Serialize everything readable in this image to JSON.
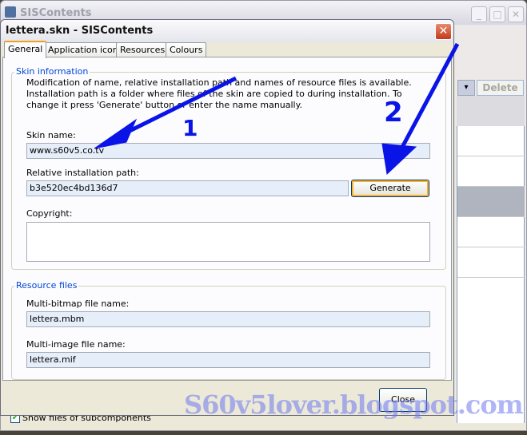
{
  "background_window": {
    "title": "SISContents",
    "delete_label": "Delete",
    "checkbox_label": "Show files of subcomponents",
    "checkbox_checked": true
  },
  "dialog": {
    "title": "lettera.skn - SISContents",
    "tabs": [
      {
        "label": "General",
        "active": true
      },
      {
        "label": "Application icons"
      },
      {
        "label": "Resources"
      },
      {
        "label": "Colours"
      }
    ],
    "skin_info": {
      "legend": "Skin information",
      "description": "Modification of name, relative installation path and names of resource files is available. Installation path is a folder where files of the skin are copied to during installation. To change it press 'Generate' button or enter the name manually.",
      "skin_name_label": "Skin name:",
      "skin_name_value": "www.s60v5.co.tv",
      "path_label": "Relative installation path:",
      "path_value": "b3e520ec4bd136d7",
      "generate_label": "Generate",
      "copyright_label": "Copyright:",
      "copyright_value": ""
    },
    "resource_files": {
      "legend": "Resource files",
      "mbm_label": "Multi-bitmap file name:",
      "mbm_value": "lettera.mbm",
      "mif_label": "Multi-image file name:",
      "mif_value": "lettera.mif"
    },
    "close_label": "Close"
  },
  "annotations": {
    "arrow1": "1",
    "arrow2": "2",
    "color": "#0a14e6"
  },
  "watermark": "S60v5lover.blogspot.com"
}
